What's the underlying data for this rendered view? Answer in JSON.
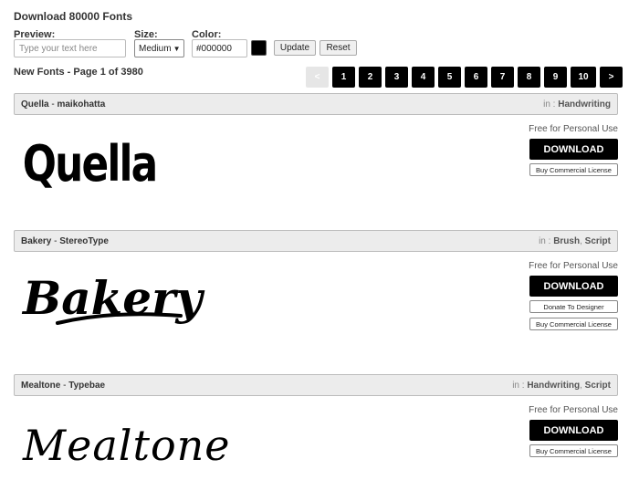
{
  "page": {
    "title": "Download 80000 Fonts"
  },
  "controls": {
    "preview_label": "Preview:",
    "preview_placeholder": "Type your text here",
    "size_label": "Size:",
    "size_value": "Medium",
    "color_label": "Color:",
    "color_value": "#000000",
    "swatch_color": "#000000",
    "update_label": "Update",
    "reset_label": "Reset"
  },
  "listing": {
    "heading": "New Fonts - Page 1 of 3980"
  },
  "pagination": {
    "prev": "<",
    "pages": [
      "1",
      "2",
      "3",
      "4",
      "5",
      "6",
      "7",
      "8",
      "9",
      "10"
    ],
    "next": ">"
  },
  "fonts": [
    {
      "name": "Quella",
      "sep": " - ",
      "designer": "maikohatta",
      "in_label": "in : ",
      "categories": [
        "Handwriting"
      ],
      "license_note": "Free for Personal Use",
      "download_label": "DOWNLOAD",
      "buy_label": "Buy Commercial License",
      "preview_text": "Quella"
    },
    {
      "name": "Bakery",
      "sep": " - ",
      "designer": "StereoType",
      "in_label": "in : ",
      "categories": [
        "Brush",
        "Script"
      ],
      "license_note": "Free for Personal Use",
      "download_label": "DOWNLOAD",
      "donate_label": "Donate To Designer",
      "buy_label": "Buy Commercial License",
      "preview_text": "Bakery"
    },
    {
      "name": "Mealtone",
      "sep": " - ",
      "designer": "Typebae",
      "in_label": "in : ",
      "categories": [
        "Handwriting",
        "Script"
      ],
      "license_note": "Free for Personal Use",
      "download_label": "DOWNLOAD",
      "buy_label": "Buy Commercial License",
      "preview_text": "Mealtone"
    }
  ],
  "colors": {
    "accent": "#000000",
    "header_bg": "#ececec"
  }
}
